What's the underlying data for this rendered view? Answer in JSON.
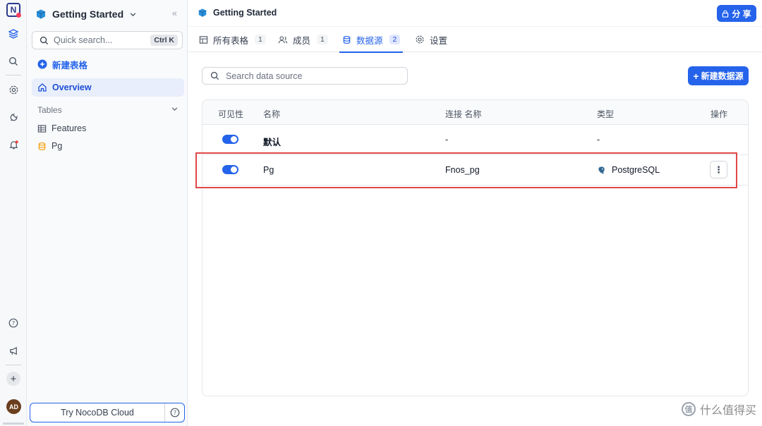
{
  "rail": {
    "icons": [
      "nocodb-logo-icon",
      "base-icon",
      "search-icon",
      "gear-icon",
      "plug-icon",
      "bell-icon",
      "help-icon",
      "megaphone-icon",
      "plus-icon"
    ],
    "avatar": "AD"
  },
  "sidebar": {
    "workspace_title": "Getting Started",
    "quick_search_placeholder": "Quick search...",
    "quick_search_shortcut": "Ctrl K",
    "new_table_label": "新建表格",
    "overview_label": "Overview",
    "tables_heading": "Tables",
    "tables": [
      "Features",
      "Pg"
    ],
    "cloud_button": "Try NocoDB Cloud"
  },
  "topbar": {
    "title": "Getting Started",
    "share_label": "分 享"
  },
  "tabs": [
    {
      "label": "所有表格",
      "count": "1"
    },
    {
      "label": "成员",
      "count": "1"
    },
    {
      "label": "数据源",
      "count": "2"
    },
    {
      "label": "设置",
      "count": ""
    }
  ],
  "datasource": {
    "search_placeholder": "Search data source",
    "new_button": "新建数据源",
    "columns": [
      "可见性",
      "名称",
      "连接 名称",
      "类型",
      "操作"
    ],
    "rows": [
      {
        "name": "默认",
        "connection": "-",
        "type": "-"
      },
      {
        "name": "Pg",
        "connection": "Fnos_pg",
        "type": "PostgreSQL"
      }
    ]
  },
  "watermark": "什么值得买",
  "colors": {
    "accent": "#2563eb",
    "highlight": "#e04848"
  }
}
